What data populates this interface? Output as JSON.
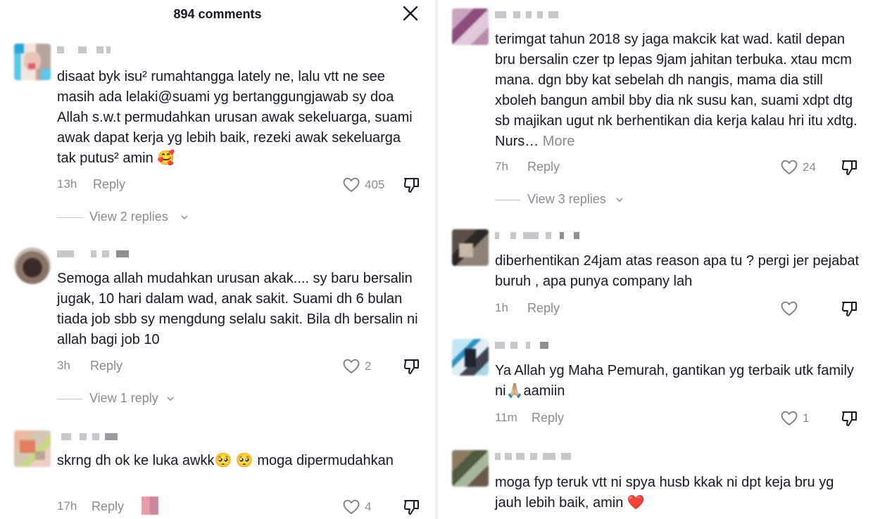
{
  "header": {
    "title": "894 comments"
  },
  "left_comments": [
    {
      "text": "disaat byk isu² rumahtangga lately ne, lalu vtt ne see masih ada lelaki@suami yg bertanggungjawab sy doa Allah s.w.t permudahkan urusan awak sekeluarga, suami awak dapat kerja yg lebih baik, rezeki awak sekeluarga tak putus² amin 🥰",
      "time": "13h",
      "reply_label": "Reply",
      "likes": "405",
      "view_replies": "View 2 replies"
    },
    {
      "text": "Semoga allah mudahkan urusan akak.... sy baru bersalin jugak, 10 hari dalam wad, anak sakit. Suami dh 6 bulan tiada job sbb sy mengdung selalu sakit. Bila dh bersalin ni allah bagi job 10",
      "time": "3h",
      "reply_label": "Reply",
      "likes": "2",
      "view_replies": "View 1 reply"
    },
    {
      "text": "skrng dh ok ke luka awkk🥺 🥺 moga dipermudahkan",
      "time": "17h",
      "reply_label": "Reply",
      "likes": "4"
    }
  ],
  "right_comments": [
    {
      "text": "terimgat tahun 2018 sy jaga makcik kat wad. katil depan bru bersalin czer tp lepas 9jam jahitan terbuka. xtau mcm mana. dgn bby kat sebelah dh nangis, mama dia still xboleh bangun ambil bby dia nk susu kan, suami xdpt dtg sb majikan ugut nk berhentikan dia kerja kalau hri itu xdtg. Nurs…",
      "more_label": "More",
      "time": "7h",
      "reply_label": "Reply",
      "likes": "24",
      "view_replies": "View 3 replies"
    },
    {
      "text": "diberhentikan 24jam atas reason apa tu ? pergi jer pejabat buruh , apa punya company lah",
      "time": "1h",
      "reply_label": "Reply",
      "likes": ""
    },
    {
      "text": "Ya Allah yg Maha Pemurah, gantikan yg terbaik utk family ni🙏🏼aamiin",
      "time": "11m",
      "reply_label": "Reply",
      "likes": "1"
    },
    {
      "text": "moga fyp teruk vtt ni spya husb kkak ni dpt keja bru yg jauh lebih baik, amin ❤️"
    }
  ],
  "icons": {
    "close": "close-icon",
    "like": "heart-outline-icon",
    "dislike": "thumbs-down-icon",
    "expand": "chevron-down-icon"
  },
  "colors": {
    "text": "#161823",
    "secondary": "#8a8b91"
  }
}
